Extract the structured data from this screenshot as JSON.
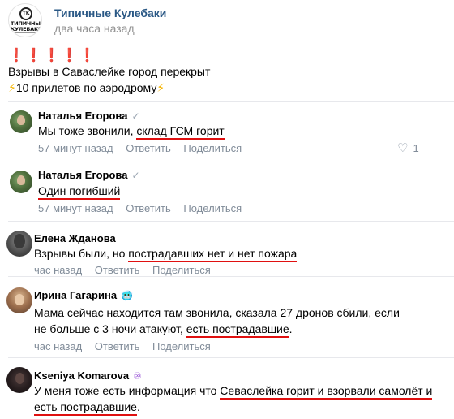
{
  "post": {
    "group_name": "Типичные Кулебаки",
    "logo_mark": "TK",
    "logo_text": "ТИПИЧНЫЕ КУЛЕБАКИ",
    "time": "два часа назад",
    "exclamations": "❗❗❗❗❗",
    "line2": "Взрывы в Саваслейке город перекрыт",
    "line3_emoji": "⚡",
    "line3_text": "10 прилетов по аэродрому",
    "line3_emoji_end": "⚡"
  },
  "actions": {
    "reply": "Ответить",
    "share": "Поделиться"
  },
  "comments": [
    {
      "author": "Наталья Егорова",
      "badge": "✓",
      "text_before": "Мы тоже звонили, ",
      "text_highlight": "склад ГСМ горит",
      "time": "57 минут назад",
      "likes": "1"
    },
    {
      "author": "Наталья Егорова",
      "badge": "✓",
      "text_highlight": "Один погибший",
      "time": "57 минут назад"
    },
    {
      "author": "Елена Жданова",
      "text_before": "Взрывы были, но ",
      "text_highlight": "пострадавших нет и нет пожара",
      "time": "час назад"
    },
    {
      "author": "Ирина Гагарина",
      "badge": "🥶",
      "line1": "Мама сейчас находится там звонила, сказала 27 дронов сбили, если",
      "line2_before": "не больше с 3 ночи атакуют, ",
      "line2_highlight": "есть пострадавшие",
      "line2_after": ".",
      "time": "час назад"
    },
    {
      "author": "Kseniya Komarova",
      "badge": "♾",
      "line1_before": "У меня тоже есть информация что ",
      "line1_highlight": "Севаслейка горит и взорвали самолёт и",
      "line2_highlight": "есть пострадавшие",
      "line2_after": "."
    }
  ],
  "colors": {
    "link": "#2a5885",
    "meta": "#818c99",
    "highlight_underline": "#e01010",
    "divider": "#e7e8ec"
  }
}
